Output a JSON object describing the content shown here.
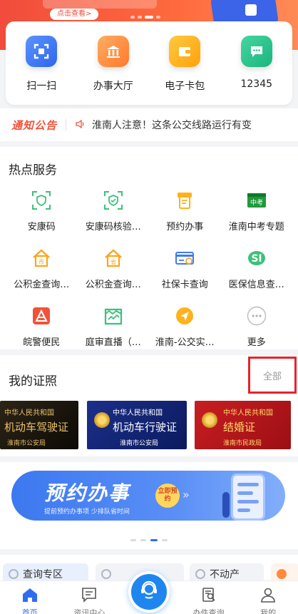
{
  "banner": {
    "button_label": "点击查看>"
  },
  "quick_actions": [
    {
      "label": "扫一扫",
      "icon": "scan-icon",
      "color": "#3e7bf5"
    },
    {
      "label": "办事大厅",
      "icon": "hall-icon",
      "color": "#ff8a3c"
    },
    {
      "label": "电子卡包",
      "icon": "wallet-icon",
      "color": "#ffb21c"
    },
    {
      "label": "12345",
      "icon": "chat-icon",
      "color": "#2bc18b"
    }
  ],
  "notice": {
    "logo": "通知公告",
    "text": "淮南人注意！这条公交线路运行有变"
  },
  "hot_services": {
    "title": "热点服务",
    "items": [
      {
        "label": "安康码",
        "icon": "health-code-icon"
      },
      {
        "label": "安康码核验…",
        "icon": "health-check-icon"
      },
      {
        "label": "预约办事",
        "icon": "appointment-icon"
      },
      {
        "label": "淮南中考专题",
        "icon": "exam-icon"
      },
      {
        "label": "公积金查询…",
        "icon": "fund-query-icon"
      },
      {
        "label": "公积金查询…",
        "icon": "fund-query-2-icon"
      },
      {
        "label": "社保卡查询",
        "icon": "social-card-icon"
      },
      {
        "label": "医保信息查…",
        "icon": "medical-insurance-icon"
      },
      {
        "label": "皖警便民",
        "icon": "police-icon"
      },
      {
        "label": "庭审直播（…",
        "icon": "court-live-icon"
      },
      {
        "label": "淮南-公交实…",
        "icon": "bus-realtime-icon"
      },
      {
        "label": "更多",
        "icon": "more-icon"
      }
    ]
  },
  "certificates": {
    "title": "我的证照",
    "all_label": "全部",
    "items": [
      {
        "top": "中华人民共和国",
        "name": "机动车驾驶证",
        "issuer": "淮南市公安局"
      },
      {
        "top": "中华人民共和国",
        "name": "机动车行驶证",
        "issuer": "淮南市公安局"
      },
      {
        "top": "中华人民共和国",
        "name": "结婚证",
        "issuer": "淮南市民政局"
      }
    ]
  },
  "promo": {
    "title": "预约办事",
    "subtitle": "提前预约办事项 少排队省时间",
    "badge": "立即预约"
  },
  "lower_tabs": [
    {
      "label": "查询专区"
    },
    {
      "label": ""
    },
    {
      "label": "不动产"
    }
  ],
  "nav": [
    {
      "label": "首页",
      "icon": "home-icon"
    },
    {
      "label": "资讯中心",
      "icon": "news-icon"
    },
    {
      "label": "",
      "icon": "service-icon"
    },
    {
      "label": "办件查询",
      "icon": "search-doc-icon"
    },
    {
      "label": "我的",
      "icon": "user-icon"
    }
  ]
}
